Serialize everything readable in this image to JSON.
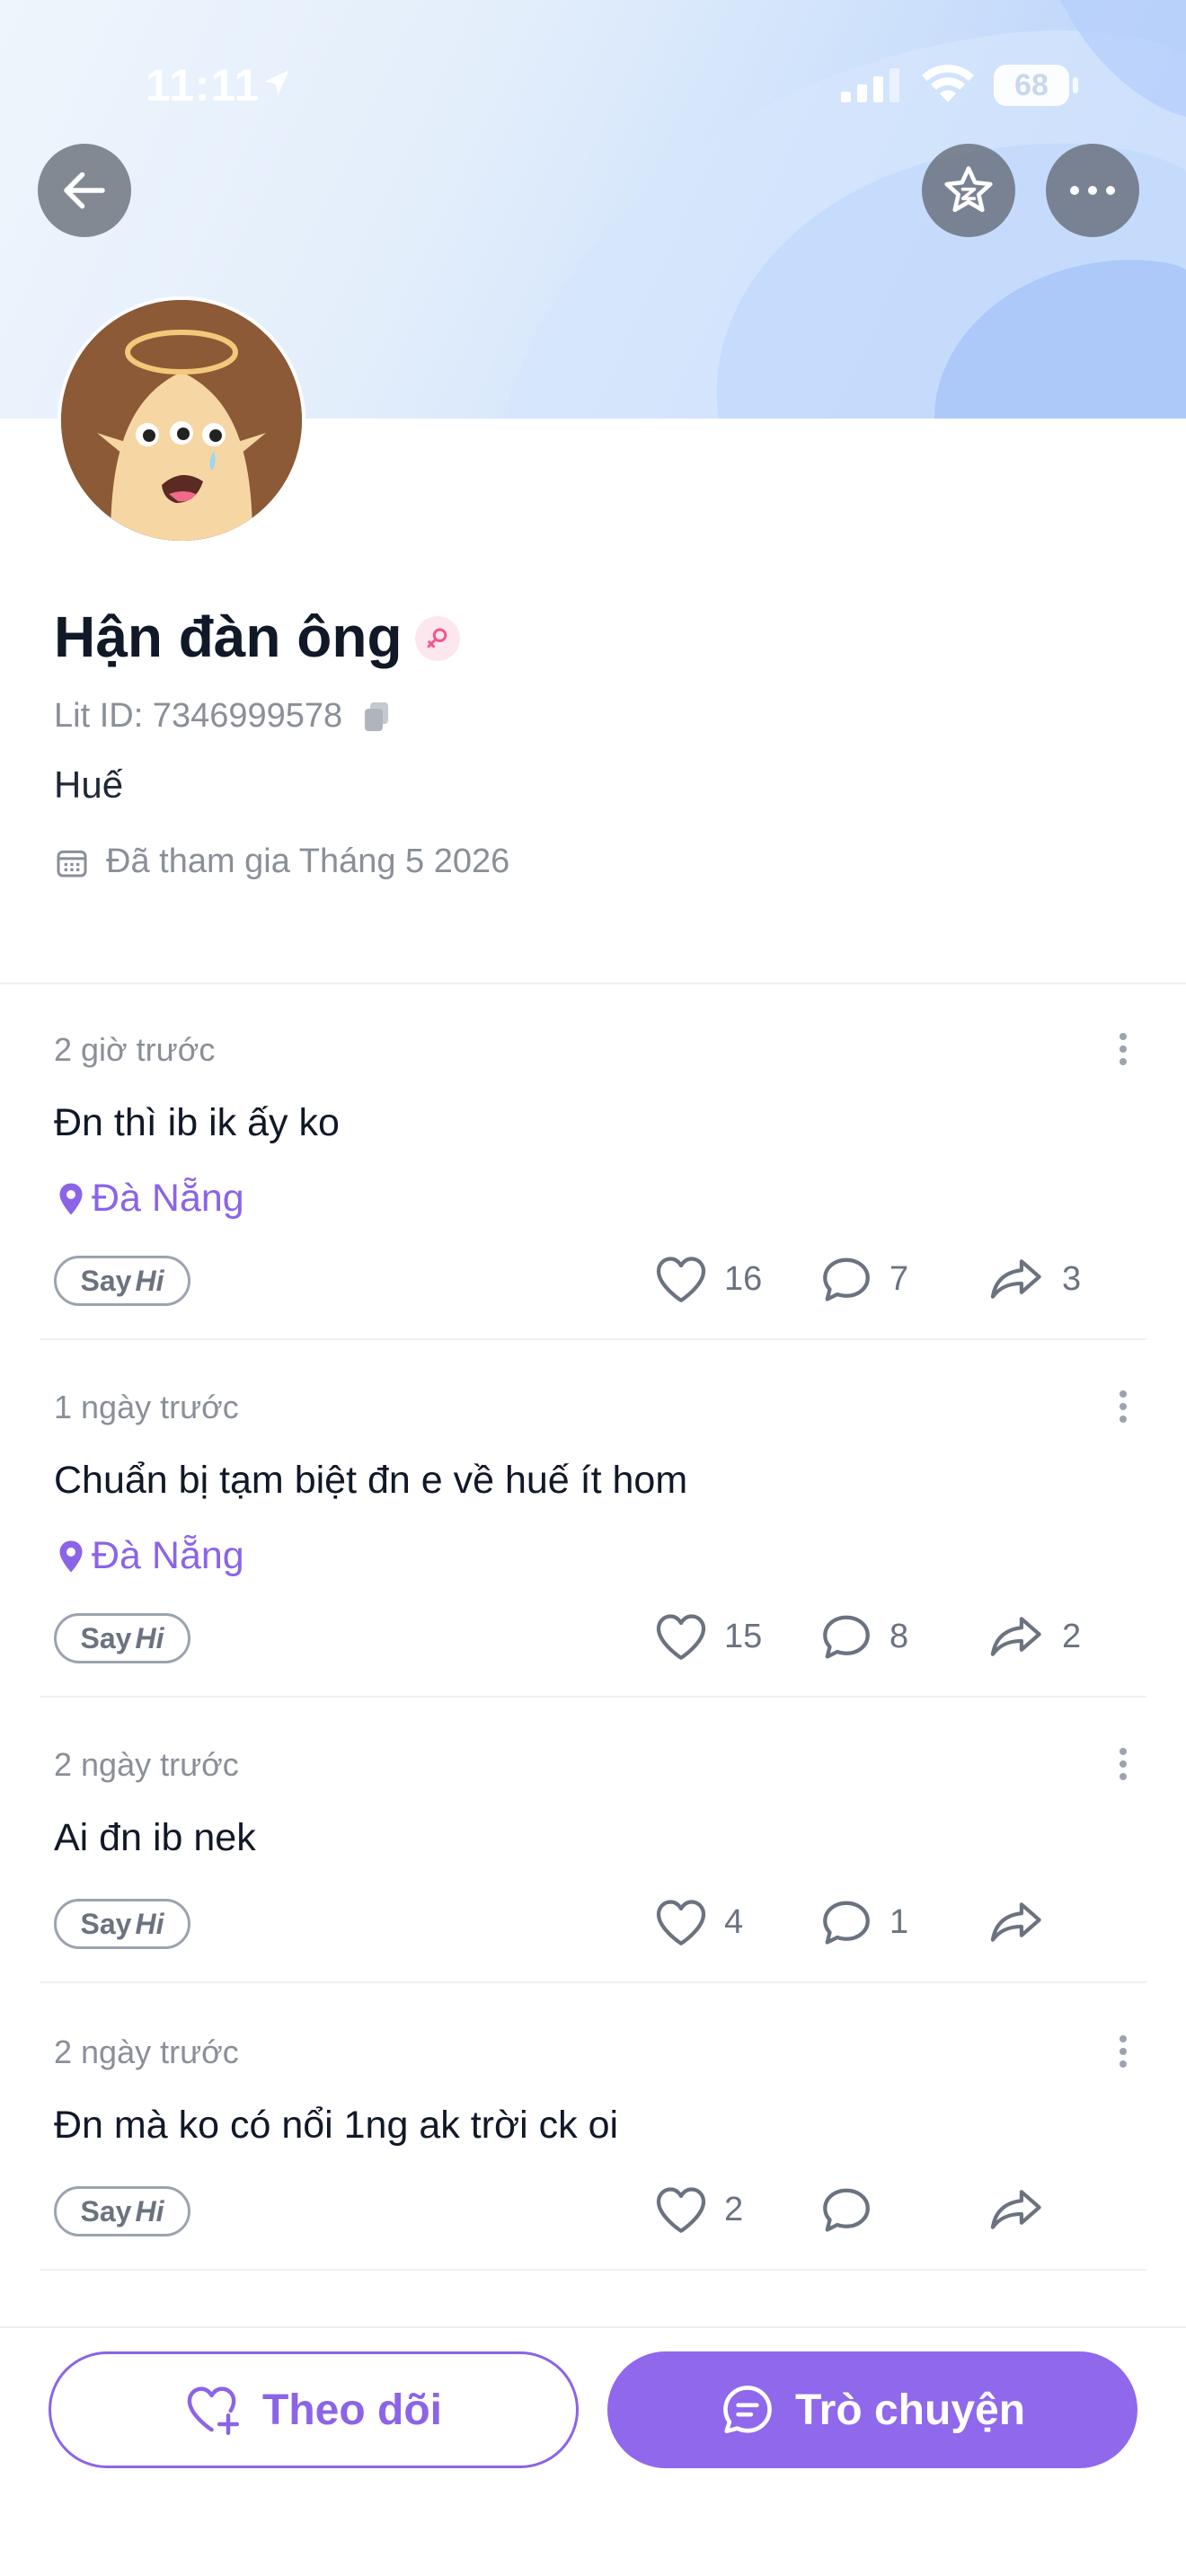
{
  "status_bar": {
    "time": "11:11",
    "battery": "68"
  },
  "profile": {
    "name": "Hận đàn ông",
    "lit_id": "Lit ID: 7346999578",
    "bio": "Huế",
    "joined": "Đã tham gia Tháng 5 2026"
  },
  "posts": [
    {
      "time": "2 giờ trước",
      "text": "Đn thì ib ik ấy ko",
      "location": "Đà Nẵng",
      "likes": "16",
      "comments": "7",
      "shares": "3"
    },
    {
      "time": "1 ngày trước",
      "text": "Chuẩn bị tạm biệt đn e về huế ít hom",
      "location": "Đà Nẵng",
      "likes": "15",
      "comments": "8",
      "shares": "2"
    },
    {
      "time": "2 ngày trước",
      "text": "Ai đn ib nek",
      "likes": "4",
      "comments": "1",
      "shares": ""
    },
    {
      "time": "2 ngày trước",
      "text": "Đn mà ko có nổi 1ng ak trời ck oi",
      "likes": "2",
      "comments": "",
      "shares": ""
    }
  ],
  "say_hi": {
    "say": "Say",
    "hi": "Hi"
  },
  "bottom": {
    "follow_label": "Theo dõi",
    "chat_label": "Trò chuyện"
  },
  "colors": {
    "accent": "#8b64e8",
    "accent_fill": "#8f68ec",
    "muted": "#8a8f98"
  },
  "icons": {
    "back": "arrow-left-icon",
    "favorite": "star-icon",
    "more": "more-horizontal-icon",
    "copy": "copy-icon",
    "calendar": "calendar-icon",
    "location": "map-pin-icon",
    "like": "heart-icon",
    "comment": "comment-icon",
    "share": "share-icon",
    "follow": "heart-plus-icon",
    "chat": "chat-icon",
    "gender": "female-icon"
  }
}
